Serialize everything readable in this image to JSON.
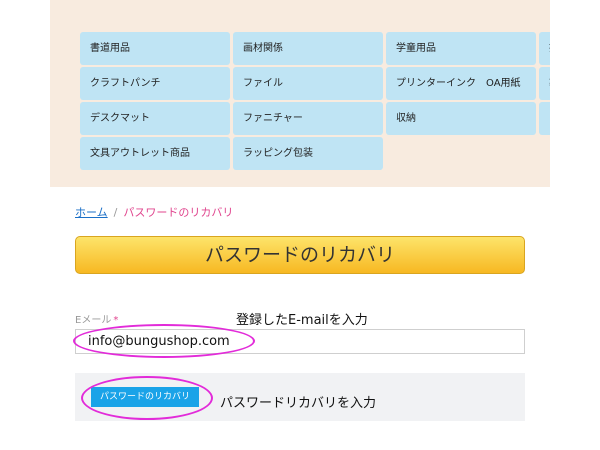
{
  "categories": [
    "書道用品",
    "画材関係",
    "学童用品",
    "指",
    "クラフトパンチ",
    "ファイル",
    "プリンターインク　OA用紙",
    "製",
    "デスクマット",
    "ファニチャー",
    "収納",
    "ノ",
    "文具アウトレット商品",
    "ラッピング包装"
  ],
  "breadcrumb": {
    "home": "ホーム",
    "separator": "/",
    "current": "パスワードのリカバリ"
  },
  "page_title": "パスワードのリカバリ",
  "form": {
    "email_label": "Eメール",
    "required_mark": "*",
    "email_value": "info@bungushop.com",
    "submit_label": "パスワードのリカバリ"
  },
  "annotations": {
    "email_hint": "登録したE-mailを入力",
    "button_hint": "パスワードリカバリを入力"
  },
  "colors": {
    "category_bg": "#bfe4f4",
    "panel_bg": "#f8ebdf",
    "title_bar": "#f7b822",
    "button": "#1aa3e8",
    "annotation_oval": "#e22bd9",
    "breadcrumb_current": "#e0458e"
  }
}
